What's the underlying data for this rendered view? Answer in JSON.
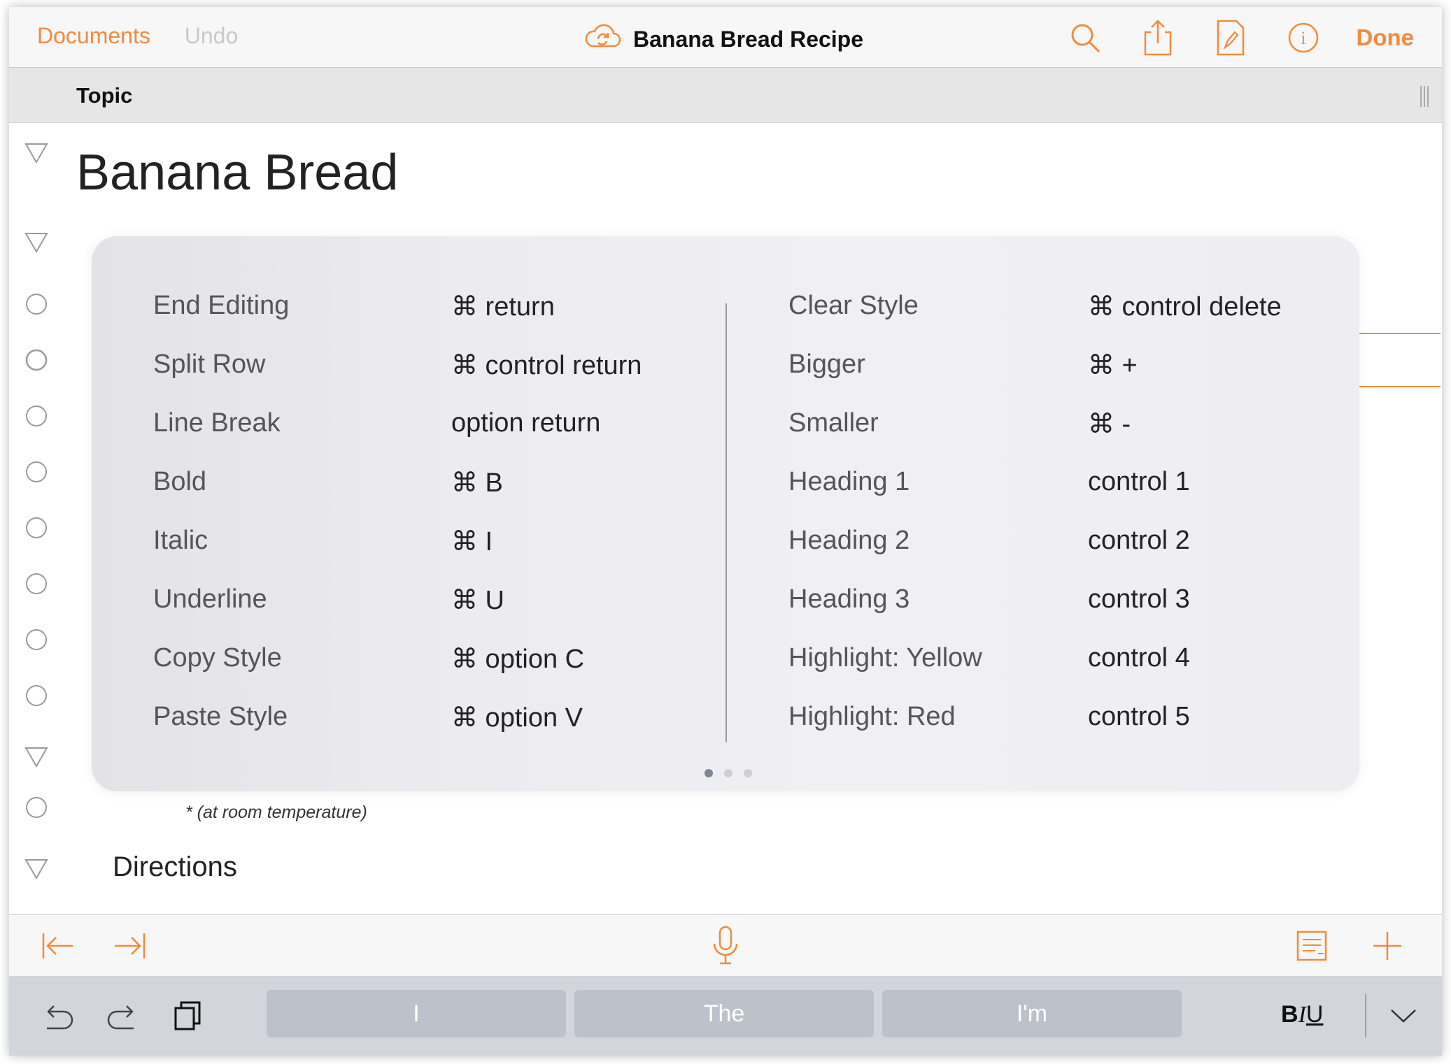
{
  "nav": {
    "documents": "Documents",
    "undo": "Undo",
    "title": "Banana Bread Recipe",
    "done": "Done",
    "icons": [
      "cloud-sync-icon",
      "search-icon",
      "share-icon",
      "document-style-icon",
      "info-icon"
    ],
    "accent_color": "#f28a3c"
  },
  "column_header": {
    "title": "Topic"
  },
  "outline": {
    "title": "Banana Bread",
    "note": "* (at room temperature)",
    "directions": "Directions"
  },
  "shortcuts": {
    "left": [
      {
        "label": "End Editing",
        "key": "⌘ return"
      },
      {
        "label": "Split Row",
        "key": "⌘ control return"
      },
      {
        "label": "Line Break",
        "key": "option return"
      },
      {
        "label": "Bold",
        "key": "⌘ B"
      },
      {
        "label": "Italic",
        "key": "⌘ I"
      },
      {
        "label": "Underline",
        "key": "⌘ U"
      },
      {
        "label": "Copy Style",
        "key": "⌘ option C"
      },
      {
        "label": "Paste Style",
        "key": "⌘ option V"
      }
    ],
    "right": [
      {
        "label": "Clear Style",
        "key": "⌘ control delete"
      },
      {
        "label": "Bigger",
        "key": "⌘ +"
      },
      {
        "label": "Smaller",
        "key": "⌘ -"
      },
      {
        "label": "Heading 1",
        "key": "control 1"
      },
      {
        "label": "Heading 2",
        "key": "control 2"
      },
      {
        "label": "Heading 3",
        "key": "control 3"
      },
      {
        "label": "Highlight: Yellow",
        "key": "control 4"
      },
      {
        "label": "Highlight: Red",
        "key": "control 5"
      }
    ],
    "page_count": 3,
    "current_page": 1
  },
  "toolbar": {
    "icons": [
      "outdent-icon",
      "indent-icon",
      "microphone-icon",
      "note-icon",
      "add-icon"
    ]
  },
  "keyboard_bar": {
    "suggestions": [
      "I",
      "The",
      "I'm"
    ],
    "format": {
      "b": "B",
      "i": "I",
      "u": "U"
    },
    "icons": [
      "undo-icon",
      "redo-icon",
      "clipboard-icon",
      "hide-keyboard-icon"
    ]
  }
}
